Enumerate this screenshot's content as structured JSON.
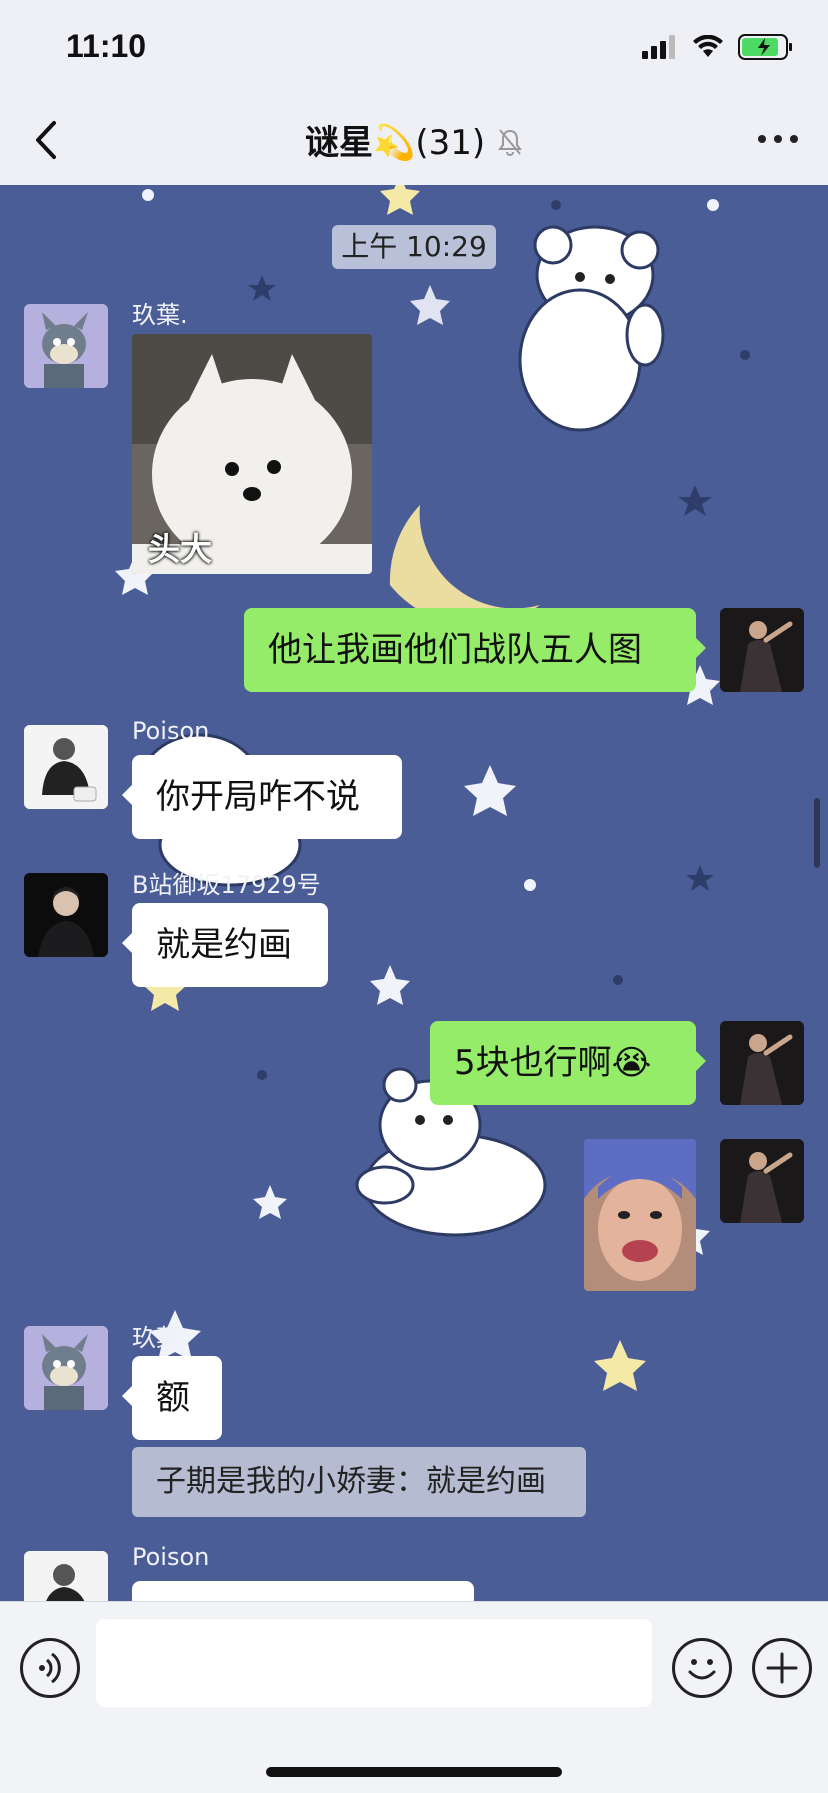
{
  "status_bar": {
    "time": "11:10"
  },
  "nav": {
    "title": "谜星💫",
    "member_count": "(31)"
  },
  "chat": {
    "timestamp": "上午 10:29",
    "messages": [
      {
        "sender": "玖葉.",
        "sticker_caption": "头大"
      },
      {
        "text": "他让我画他们战队五人图"
      },
      {
        "sender": "Poison",
        "text": "你开局咋不说"
      },
      {
        "sender": "B站御坂17929号",
        "text": "就是约画"
      },
      {
        "text": "5块也行啊😭"
      },
      {
        "sender": "玖葉.",
        "text": "额",
        "quote": "子期是我的小娇妻：就是约画"
      },
      {
        "sender": "Poison"
      }
    ]
  },
  "colors": {
    "wallpaper": "#4a5d97",
    "outgoing_bubble": "#95ec69",
    "incoming_bubble": "#ffffff"
  }
}
